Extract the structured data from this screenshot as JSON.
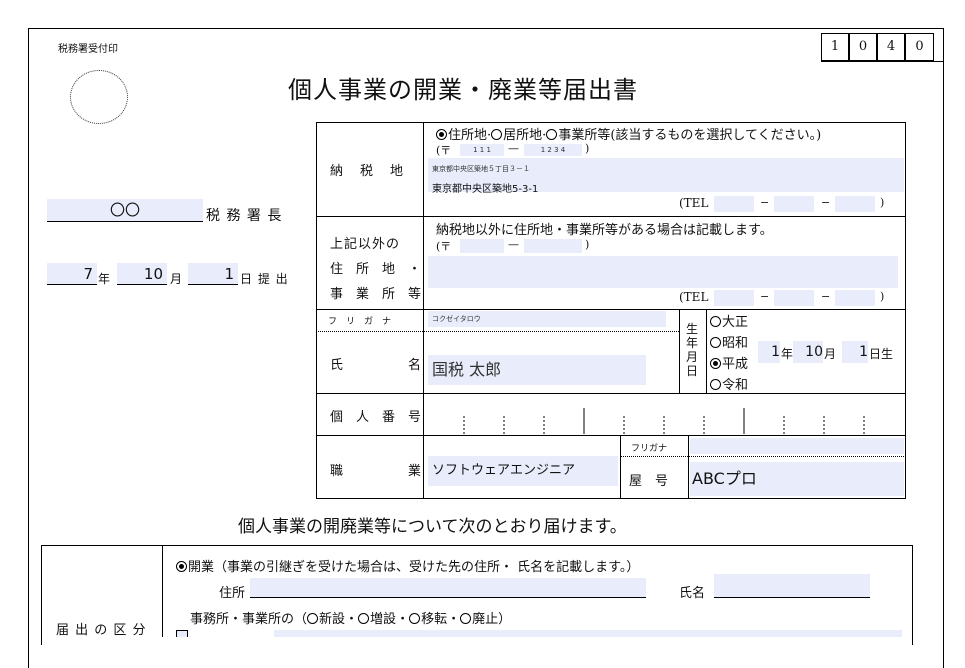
{
  "stamp_label": "税務署受付印",
  "code_digits": [
    "1",
    "0",
    "4",
    "0"
  ],
  "title": "個人事業の開業・廃業等届出書",
  "tax_office": {
    "name": "〇〇",
    "suffix": "税 務 署 長"
  },
  "submit_date": {
    "year": "7",
    "year_unit": "年",
    "month": "10",
    "month_unit": "月",
    "day": "1",
    "day_unit": "日 提 出"
  },
  "nozeichi": {
    "label": "納　税　地",
    "options": [
      "住所地",
      "居所地",
      "事業所等"
    ],
    "option_note": "(該当するものを選択してください。)",
    "postal_open": "(〒",
    "postal_a": "1 1 1",
    "postal_dash": "—",
    "postal_b": "1 2 3 4",
    "postal_close": ")",
    "address_small": "東京都中央区築地５丁目３－１",
    "address": "東京都中央区築地5-3-1",
    "tel": "(TEL",
    "tel_dash1": "−",
    "tel_dash2": "−",
    "tel_close": ")"
  },
  "other_address": {
    "label_lines": [
      "上記以外の",
      "住　所　地　・",
      "事　業　所　等"
    ],
    "note": "納税地以外に住所地・事業所等がある場合は記載します。",
    "postal_open": "(〒",
    "postal_dash": "—",
    "postal_close": ")",
    "tel": "(TEL",
    "tel_dash1": "−",
    "tel_dash2": "−",
    "tel_close": ")"
  },
  "furigana": {
    "label": "フ　リ　ガ　ナ",
    "value": "コクゼイタロウ"
  },
  "name": {
    "label": "氏　　　　　名",
    "value": "国税 太郎"
  },
  "birth": {
    "label": "生年月日",
    "eras": [
      "大正",
      "昭和",
      "平成",
      "令和"
    ],
    "selected": "平成",
    "year": "1",
    "year_unit": "年",
    "month": "10",
    "month_unit": "月",
    "day": "1",
    "day_unit": "日生"
  },
  "my_number": {
    "label": "個　人　番　号"
  },
  "occupation": {
    "label": "職　　　　　業",
    "value": "ソフトウェアエンジニア"
  },
  "yago": {
    "furigana_label": "フリガナ",
    "label": "屋　号",
    "value": "ABCプロ"
  },
  "statement": "個人事業の開廃業等について次のとおり届けます。",
  "todoke": {
    "label": "届 出 の 区 分",
    "kaigyo": "開業（事業の引継ぎを受けた場合は、受けた先の住所・ 氏名を記載します。）",
    "address_label": "住所",
    "name_label": "氏名",
    "office_prefix": "事務所・事業所の（",
    "office_options": [
      "新設",
      "増設",
      "移転",
      "廃止"
    ],
    "office_suffix": "）"
  }
}
